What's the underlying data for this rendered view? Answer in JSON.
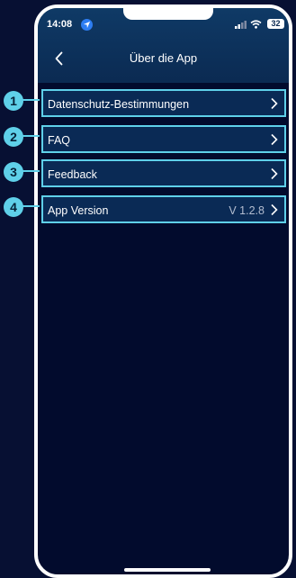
{
  "status_bar": {
    "time": "14:08",
    "battery": "32"
  },
  "header": {
    "title": "Über die App"
  },
  "menu": {
    "items": [
      {
        "label": "Datenschutz-Bestimmungen",
        "value": ""
      },
      {
        "label": "FAQ",
        "value": ""
      },
      {
        "label": "Feedback",
        "value": ""
      },
      {
        "label": "App Version",
        "value": "V 1.2.8"
      }
    ]
  },
  "callouts": [
    "1",
    "2",
    "3",
    "4"
  ],
  "colors": {
    "accent": "#5fd0e9",
    "background": "#020b2d",
    "header": "#0b2a52"
  }
}
